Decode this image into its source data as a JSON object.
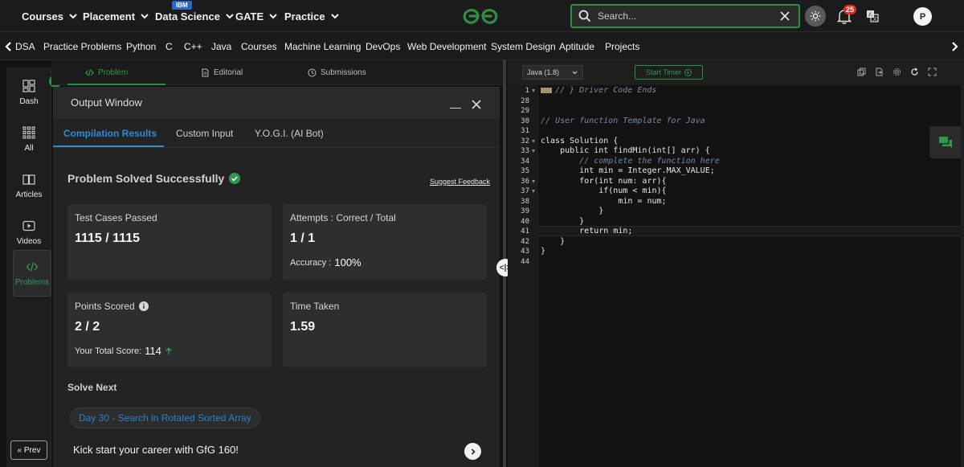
{
  "topnav": {
    "items": [
      "Courses",
      "Placement",
      "Data Science",
      "GATE",
      "Practice"
    ],
    "ibm_badge": "IBM",
    "search_placeholder": "Search...",
    "notification_count": "25",
    "avatar_letter": "P"
  },
  "subnav": {
    "items": [
      "DSA",
      "Practice Problems",
      "Python",
      "C",
      "C++",
      "Java",
      "Courses",
      "Machine Learning",
      "DevOps",
      "Web Development",
      "System Design",
      "Aptitude",
      "Projects"
    ]
  },
  "rail": {
    "items": [
      "Dash",
      "All",
      "Articles",
      "Videos",
      "Problems"
    ],
    "prev_label": "« Prev"
  },
  "problem_tabs": [
    "Problem",
    "Editorial",
    "Submissions"
  ],
  "output_window": {
    "title": "Output Window",
    "tabs": [
      "Compilation Results",
      "Custom Input",
      "Y.O.G.I. (AI Bot)"
    ],
    "status": "Problem Solved Successfully",
    "suggest_feedback": "Suggest Feedback",
    "cards": {
      "test_cases_label": "Test Cases Passed",
      "test_cases_value": "1115 / 1115",
      "attempts_label": "Attempts : Correct / Total",
      "attempts_value": "1 / 1",
      "accuracy_label": "Accuracy :",
      "accuracy_value": "100%",
      "points_label": "Points Scored",
      "points_value": "2 / 2",
      "total_score_label": "Your Total Score:",
      "total_score_value": "114",
      "time_label": "Time Taken",
      "time_value": "1.59"
    },
    "solve_next_label": "Solve Next",
    "next_problem": "Day 30 - Search in Rotated Sorted Array",
    "kick_start": "Kick start your career with GfG 160!"
  },
  "editor": {
    "language": "Java (1.8)",
    "timer_label": "Start Timer",
    "line_numbers": [
      "1",
      "28",
      "29",
      "30",
      "31",
      "32",
      "33",
      "34",
      "35",
      "36",
      "37",
      "38",
      "39",
      "40",
      "41",
      "42",
      "43",
      "44"
    ],
    "lines": [
      "// } Driver Code Ends",
      "",
      "",
      "// User function Template for Java",
      "",
      "class Solution {",
      "    public int findMin(int[] arr) {",
      "        // complete the function here",
      "        int min = Integer.MAX_VALUE;",
      "        for(int num: arr){",
      "            if(num < min){",
      "                min = num;",
      "            }",
      "        }",
      "        return min;",
      "    }",
      "}",
      ""
    ]
  },
  "colors": {
    "brand_green": "#2f8d46",
    "link_blue": "#2e8bd6",
    "badge_red": "#e02b2b"
  }
}
